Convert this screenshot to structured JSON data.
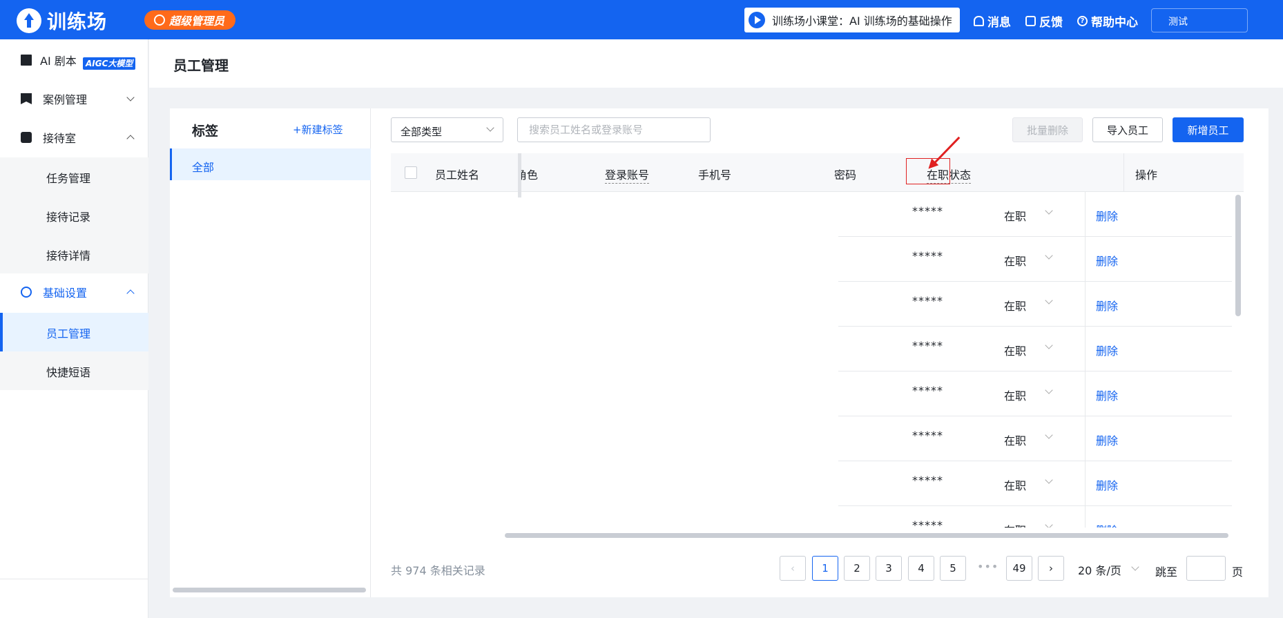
{
  "header": {
    "logo_text": "训练场",
    "role_badge": "超级管理员",
    "course_text": "训练场小课堂：AI 训练场的基础操作",
    "nav": {
      "messages": "消息",
      "feedback": "反馈",
      "help": "帮助中心"
    },
    "user": "测试"
  },
  "sidebar": {
    "ai_script": "AI 剧本",
    "aigc_badge": "AIGC大模型",
    "case_mgmt": "案例管理",
    "reception": "接待室",
    "reception_items": [
      "任务管理",
      "接待记录",
      "接待详情"
    ],
    "settings": "基础设置",
    "settings_items": [
      "员工管理",
      "快捷短语"
    ]
  },
  "page": {
    "title": "员工管理"
  },
  "tags": {
    "title": "标签",
    "new_label": "+新建标签",
    "items": [
      "全部"
    ]
  },
  "toolbar": {
    "type_select": "全部类型",
    "search_placeholder": "搜索员工姓名或登录账号",
    "batch_delete": "批量删除",
    "import": "导入员工",
    "add": "新增员工"
  },
  "table": {
    "columns": {
      "name": "员工姓名",
      "role": "角色",
      "account": "登录账号",
      "phone": "手机号",
      "password": "密码",
      "status": "在职状态",
      "actions": "操作"
    },
    "rows": [
      {
        "password": "*****",
        "status": "在职",
        "action": "删除"
      },
      {
        "password": "*****",
        "status": "在职",
        "action": "删除"
      },
      {
        "password": "*****",
        "status": "在职",
        "action": "删除"
      },
      {
        "password": "*****",
        "status": "在职",
        "action": "删除"
      },
      {
        "password": "*****",
        "status": "在职",
        "action": "删除"
      },
      {
        "password": "*****",
        "status": "在职",
        "action": "删除"
      },
      {
        "password": "*****",
        "status": "在职",
        "action": "删除"
      },
      {
        "password": "*****",
        "status": "在职",
        "action": "删除"
      }
    ]
  },
  "pagination": {
    "total": "共 974 条相关记录",
    "pages": [
      "1",
      "2",
      "3",
      "4",
      "5"
    ],
    "dots": "•••",
    "last": "49",
    "active": "1",
    "page_size": "20 条/页",
    "jump_label": "跳至",
    "jump_unit": "页"
  },
  "colors": {
    "primary": "#1464f0",
    "badge": "#ff6a1a",
    "highlight": "#e02020"
  }
}
